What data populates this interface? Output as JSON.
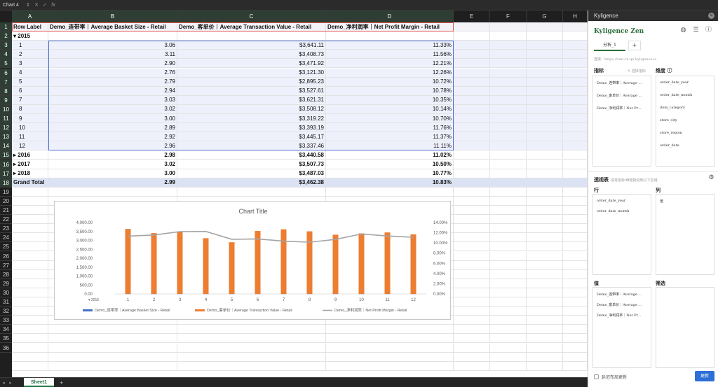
{
  "formula_bar": {
    "name_box": "Chart 4",
    "fx_symbol": "fx",
    "cancel_symbol": "✕",
    "confirm_symbol": "✓"
  },
  "columns": [
    "A",
    "B",
    "C",
    "D",
    "E",
    "F",
    "G",
    "H"
  ],
  "row_numbers": [
    "1",
    "2",
    "3",
    "4",
    "5",
    "6",
    "7",
    "8",
    "9",
    "10",
    "11",
    "12",
    "13",
    "14",
    "15",
    "16",
    "17",
    "18",
    "19",
    "20",
    "21",
    "22",
    "23",
    "24",
    "25",
    "26",
    "27",
    "28",
    "29",
    "30",
    "31",
    "32",
    "33",
    "34",
    "35",
    "36"
  ],
  "pivot": {
    "headers": [
      "Row Label",
      "Demo_连带率｜Average Basket Size - Retail",
      "Demo_客单价｜Average Transaction Value - Retail",
      "Demo_净利润率｜Net Profit Margin - Retail"
    ],
    "rows": [
      {
        "label": "▾ 2015",
        "b": "",
        "c": "",
        "d": "",
        "type": "bold"
      },
      {
        "label": "1",
        "b": "3.06",
        "c": "$3,641.11",
        "d": "11.33%",
        "type": "month"
      },
      {
        "label": "2",
        "b": "3.11",
        "c": "$3,408.73",
        "d": "11.56%",
        "type": "month"
      },
      {
        "label": "3",
        "b": "2.90",
        "c": "$3,471.92",
        "d": "12.21%",
        "type": "month"
      },
      {
        "label": "4",
        "b": "2.76",
        "c": "$3,121.30",
        "d": "12.26%",
        "type": "month"
      },
      {
        "label": "5",
        "b": "2.79",
        "c": "$2,895.23",
        "d": "10.72%",
        "type": "month"
      },
      {
        "label": "6",
        "b": "2.94",
        "c": "$3,527.61",
        "d": "10.78%",
        "type": "month"
      },
      {
        "label": "7",
        "b": "3.03",
        "c": "$3,621.31",
        "d": "10.35%",
        "type": "month"
      },
      {
        "label": "8",
        "b": "3.02",
        "c": "$3,508.12",
        "d": "10.14%",
        "type": "month"
      },
      {
        "label": "9",
        "b": "3.00",
        "c": "$3,319.22",
        "d": "10.70%",
        "type": "month"
      },
      {
        "label": "10",
        "b": "2.89",
        "c": "$3,393.19",
        "d": "11.76%",
        "type": "month"
      },
      {
        "label": "11",
        "b": "2.92",
        "c": "$3,445.17",
        "d": "11.37%",
        "type": "month"
      },
      {
        "label": "12",
        "b": "2.96",
        "c": "$3,337.46",
        "d": "11.11%",
        "type": "month"
      },
      {
        "label": "▸ 2016",
        "b": "2.98",
        "c": "$3,440.58",
        "d": "11.02%",
        "type": "bold"
      },
      {
        "label": "▸ 2017",
        "b": "3.02",
        "c": "$3,507.73",
        "d": "10.50%",
        "type": "bold"
      },
      {
        "label": "▸ 2018",
        "b": "3.00",
        "c": "$3,487.03",
        "d": "10.77%",
        "type": "bold"
      },
      {
        "label": "Grand Total",
        "b": "2.99",
        "c": "$3,462.38",
        "d": "10.83%",
        "type": "total"
      }
    ]
  },
  "chart_data": {
    "type": "bar",
    "title": "Chart Title",
    "categories": [
      "1",
      "2",
      "3",
      "4",
      "5",
      "6",
      "7",
      "8",
      "9",
      "10",
      "11",
      "12"
    ],
    "category_group": "▾ 2015",
    "series": [
      {
        "name": "Demo_连带率｜Average Basket Size - Retail",
        "type": "bar",
        "axis": "left",
        "values": [
          3.06,
          3.11,
          2.9,
          2.76,
          2.79,
          2.94,
          3.03,
          3.02,
          3.0,
          2.89,
          2.92,
          2.96
        ],
        "color": "#4472c4"
      },
      {
        "name": "Demo_客单价｜Average Transaction Value - Retail",
        "type": "bar",
        "axis": "left",
        "values": [
          3641.11,
          3408.73,
          3471.92,
          3121.3,
          2895.23,
          3527.61,
          3621.31,
          3508.12,
          3319.22,
          3393.19,
          3445.17,
          3337.46
        ],
        "color": "#ed7d31"
      },
      {
        "name": "Demo_净利润率｜Net Profit Margin - Retail",
        "type": "line",
        "axis": "right",
        "values": [
          11.33,
          11.56,
          12.21,
          12.26,
          10.72,
          10.78,
          10.35,
          10.14,
          10.7,
          11.76,
          11.37,
          11.11
        ],
        "color": "#a5a5a5"
      }
    ],
    "y_left": {
      "ylim": [
        0,
        4000
      ],
      "ticks": [
        "4,000.00",
        "3,500.00",
        "3,000.00",
        "2,500.00",
        "2,000.00",
        "1,500.00",
        "1,000.00",
        "500.00",
        "0.00"
      ]
    },
    "y_right": {
      "ylim": [
        0,
        14
      ],
      "ticks": [
        "14.00%",
        "12.00%",
        "10.00%",
        "8.00%",
        "6.00%",
        "4.00%",
        "2.00%",
        "0.00%"
      ]
    },
    "legend_position": "bottom",
    "grid": false
  },
  "tabs": {
    "sheet_name": "Sheet1",
    "add_symbol": "+"
  },
  "panel": {
    "title": "Kyligence",
    "close_symbol": "×",
    "brand": "Kyligence Zen",
    "tab_label": "分析_1",
    "tab_add": "+",
    "connection": "连接：https://zen-cn-qa.kyligence.io",
    "metrics_label": "指标",
    "select_metrics": "✎ 选择指标",
    "dimensions_label": "维度 ⓘ",
    "metrics": [
      "Demo_连带率｜Average ...",
      "Demo_客单价｜Average ...",
      "Demo_净利润率｜Net Pr..."
    ],
    "dimensions": [
      "order_date_year",
      "order_date_month",
      "item_category",
      "store_city",
      "store_region",
      "order_date"
    ],
    "pivot_label": "透视表",
    "pivot_hint": "请将指标/维度拖动到以下区域",
    "rows_label": "行",
    "rows_items": [
      "order_date_year",
      "order_date_month"
    ],
    "cols_label": "列",
    "cols_items": [
      "值"
    ],
    "values_label": "值",
    "values_items": [
      "Demo_连带率｜Average ...",
      "Demo_客单价｜Average ...",
      "Demo_净利润率｜Net Pr..."
    ],
    "filter_label": "筛选",
    "defer_label": "延迟布局更新",
    "update_button": "更新"
  }
}
